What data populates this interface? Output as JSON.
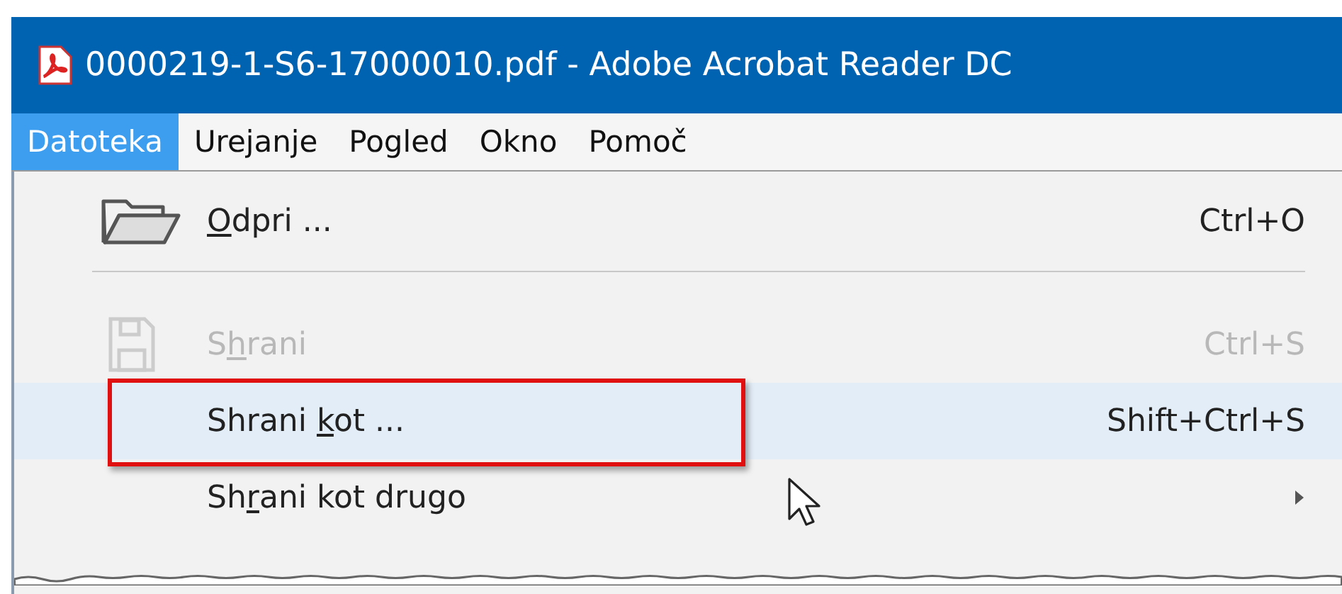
{
  "window": {
    "title": "0000219-1-S6-17000010.pdf - Adobe Acrobat Reader DC"
  },
  "menu_bar": [
    {
      "label": "Datoteka",
      "selected": true
    },
    {
      "label": "Urejanje",
      "selected": false
    },
    {
      "label": "Pogled",
      "selected": false
    },
    {
      "label": "Okno",
      "selected": false
    },
    {
      "label": "Pomoč",
      "selected": false
    }
  ],
  "menu_items": [
    {
      "kind": "folder-item",
      "label": {
        "key": "O",
        "after": "dpri ..."
      },
      "shortcut": "Ctrl+O",
      "disabled": false,
      "selected": false,
      "annotated": false
    },
    {
      "kind": "separator"
    },
    {
      "kind": "floppy-item",
      "label": {
        "before": "S",
        "key": "h",
        "after": "rani"
      },
      "shortcut": "Ctrl+S",
      "disabled": true,
      "selected": false,
      "annotated": false
    },
    {
      "kind": "plain-item",
      "label": {
        "before": "Shrani ",
        "key": "k",
        "after": "ot ..."
      },
      "shortcut": "Shift+Ctrl+S",
      "disabled": false,
      "selected": true,
      "annotated": true
    },
    {
      "kind": "submenu-item",
      "label": {
        "before": "Sh",
        "key": "r",
        "after": "ani kot drugo"
      },
      "disabled": false,
      "selected": false,
      "annotated": false
    }
  ]
}
